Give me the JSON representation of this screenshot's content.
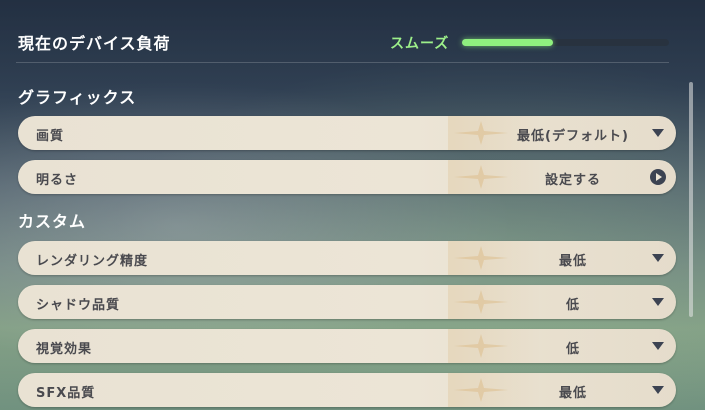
{
  "device_load": {
    "title": "現在のデバイス負荷",
    "status": "スムーズ",
    "status_color": "#9df08a",
    "level_fraction": 0.44
  },
  "sections": {
    "graphics": "グラフィックス",
    "custom": "カスタム"
  },
  "graphics_rows": [
    {
      "label": "画質",
      "value": "最低(デフォルト)",
      "control": "dropdown"
    },
    {
      "label": "明るさ",
      "value": "設定する",
      "control": "arrow"
    }
  ],
  "custom_rows": [
    {
      "label": "レンダリング精度",
      "value": "最低",
      "control": "dropdown"
    },
    {
      "label": "シャドウ品質",
      "value": "低",
      "control": "dropdown"
    },
    {
      "label": "視覚効果",
      "value": "低",
      "control": "dropdown"
    },
    {
      "label": "SFX品質",
      "value": "最低",
      "control": "dropdown"
    }
  ],
  "icons": {
    "dropdown": "chevron-down-icon",
    "arrow": "arrow-right-icon",
    "star": "star-decoration-icon"
  }
}
